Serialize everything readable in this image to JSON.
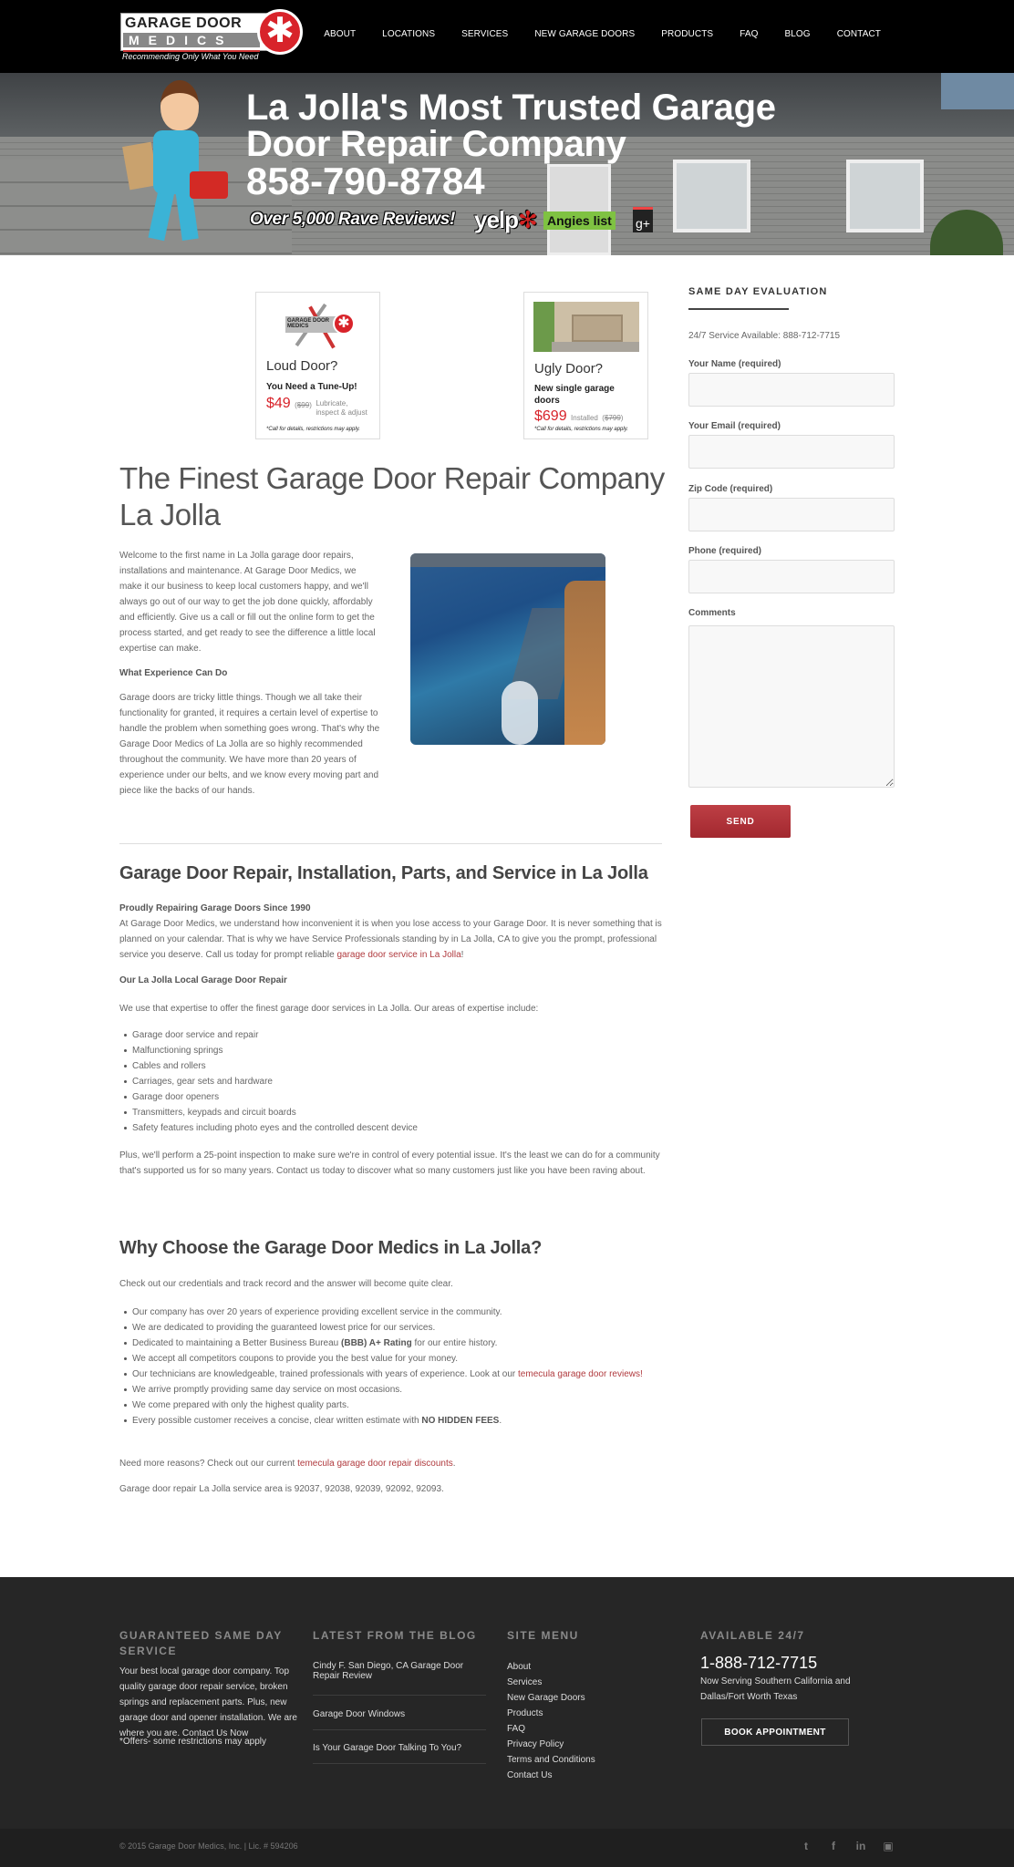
{
  "header": {
    "logo": {
      "line1": "GARAGE DOOR",
      "line2": "MEDICS",
      "tagline": "Recommending Only What You Need",
      "icon": "star-of-life-icon"
    },
    "nav": [
      "ABOUT",
      "LOCATIONS",
      "SERVICES",
      "NEW GARAGE DOORS",
      "PRODUCTS",
      "FAQ",
      "BLOG",
      "CONTACT"
    ]
  },
  "hero": {
    "title_line1": "La Jolla's Most Trusted Garage",
    "title_line2": "Door Repair Company",
    "phone": "858-790-8784",
    "reviews": "Over 5,000 Rave Reviews!",
    "badges": {
      "yelp": "yelp",
      "angies": "Angies list",
      "gplus": "g+"
    }
  },
  "promos": [
    {
      "title": "Loud Door?",
      "subtitle": "You Need a Tune-Up!",
      "price": "$49",
      "old_price": "$99",
      "note": "Lubricate, inspect & adjust",
      "fine": "*Call for details, restrictions may apply."
    },
    {
      "title": "Ugly Door?",
      "subtitle": "New single garage doors",
      "price": "$699",
      "note": "Installed",
      "old_price": "$799",
      "fine": "*Call for details, restrictions may apply."
    }
  ],
  "section1": {
    "heading": "The Finest Garage Door Repair Company La Jolla",
    "intro": "Welcome to the first name in La Jolla garage door repairs, installations and maintenance. At Garage Door Medics, we make it our business to keep local customers happy, and we'll always go out of our way to get the job done quickly, affordably and efficiently. Give us a call or fill out the online form to get the process started, and get ready to see the difference a little local expertise can make.",
    "subheading": "What Experience Can Do",
    "body": "Garage doors are tricky little things. Though we all take their functionality for granted, it requires a certain level of expertise to handle the problem when something goes wrong. That's why the Garage Door Medics of La Jolla are so highly recommended throughout the community. We have more than 20 years of experience under our belts, and we know every moving part and piece like the backs of our hands."
  },
  "section2": {
    "heading": "Garage Door Repair, Installation, Parts, and Service in La Jolla",
    "bold": "Proudly Repairing Garage Doors Since 1990",
    "para": "At Garage Door Medics, we understand how inconvenient it is when you lose access to your Garage Door. It is never something that is planned on your calendar. That is why we have Service Professionals standing by in La Jolla, CA to give you the prompt, professional service you deserve. Call us today for prompt reliable ",
    "para_link": "garage door service in La Jolla",
    "para_end": "!",
    "subheading": "Our La Jolla Local Garage Door Repair",
    "intro": "We use that expertise to offer the finest garage door services in La Jolla. Our areas of expertise include:",
    "list": [
      "Garage door service and repair",
      "Malfunctioning springs",
      "Cables and rollers",
      "Carriages, gear sets and hardware",
      "Garage door openers",
      "Transmitters, keypads and circuit boards",
      "Safety features including photo eyes and the controlled descent device"
    ],
    "closing": "Plus, we'll perform a 25-point inspection to make sure we're in control of every potential issue. It's the least we can do for a community that's supported us for so many years. Contact us today to discover what so many customers just like you have been raving about."
  },
  "section3": {
    "heading": "Why Choose the Garage Door Medics in La Jolla?",
    "intro": "Check out our credentials and track record and the answer will become quite clear.",
    "list": [
      "Our company has over 20 years of experience providing excellent service in the community.",
      "We are dedicated to providing the guaranteed lowest price for our services.",
      "Dedicated to maintaining a Better Business Bureau ",
      "We accept all competitors coupons to provide you the best value for your money.",
      "Our technicians are knowledgeable, trained professionals with years of experience.  Look at our ",
      "We arrive promptly providing same day service on most occasions.",
      "We come prepared with only the highest quality parts.",
      "Every possible customer receives a concise, clear written estimate with "
    ],
    "bbb_bold": "(BBB) A+ Rating",
    "bbb_end": " for our entire history.",
    "reviews_link": "temecula garage door reviews",
    "reviews_end": "!",
    "fees_bold": "NO HIDDEN FEES",
    "fees_end": ".",
    "need_more": "Need more reasons?  Check out our current ",
    "discounts_link": "temecula garage door repair discounts",
    "need_more_end": ".",
    "service_area": "Garage door repair La Jolla service area is 92037, 92038, 92039, 92092, 92093."
  },
  "sidebar": {
    "title": "SAME DAY EVALUATION",
    "service": "24/7 Service Available: 888-712-7715",
    "fields": [
      {
        "label": "Your Name (required)",
        "value": ""
      },
      {
        "label": "Your Email (required)",
        "value": ""
      },
      {
        "label": "Zip Code (required)",
        "value": ""
      },
      {
        "label": "Phone (required)",
        "value": ""
      }
    ],
    "comments_label": "Comments",
    "comments_value": "",
    "send": "SEND"
  },
  "footer": {
    "col1": {
      "title": "GUARANTEED SAME DAY SERVICE",
      "text": "Your best local garage door company. Top quality garage door repair service, broken springs and replacement parts. Plus, new garage door and opener installation. We are where you are. Contact Us Now",
      "offer": "*Offers- some restrictions may apply"
    },
    "col2": {
      "title": "LATEST FROM THE BLOG",
      "posts": [
        "Cindy F. San Diego, CA Garage Door Repair Review",
        "Garage Door Windows",
        "Is Your Garage Door Talking To You?"
      ]
    },
    "col3": {
      "title": "SITE MENU",
      "links": [
        "About",
        "Services",
        "New Garage Doors",
        "Products",
        "FAQ",
        "Privacy Policy",
        "Terms and Conditions",
        "Contact Us"
      ]
    },
    "col4": {
      "title": "AVAILABLE 24/7",
      "phone": "1-888-712-7715",
      "serving": "Now Serving Southern California and Dallas/Fort Worth Texas",
      "book": "BOOK APPOINTMENT"
    },
    "copyright": "© 2015 Garage Door Medics, Inc. | Lic. # 594206",
    "social": [
      {
        "name": "twitter-icon",
        "glyph": "𝕥"
      },
      {
        "name": "facebook-icon",
        "glyph": "f"
      },
      {
        "name": "linkedin-icon",
        "glyph": "in"
      },
      {
        "name": "youtube-icon",
        "glyph": "▶"
      }
    ]
  },
  "colors": {
    "accent": "#b03a3e",
    "price_red": "#d8232a",
    "footer_bg": "#262626",
    "header_bg": "#000000"
  }
}
